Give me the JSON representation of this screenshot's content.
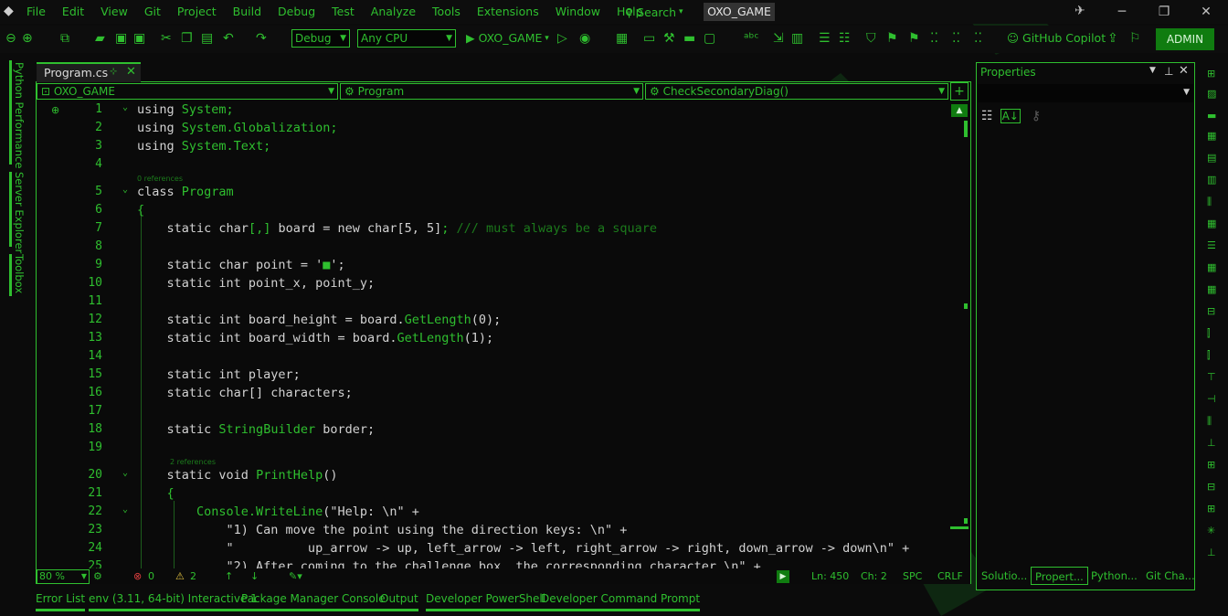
{
  "menu": [
    "File",
    "Edit",
    "View",
    "Git",
    "Project",
    "Build",
    "Debug",
    "Test",
    "Analyze",
    "Tools",
    "Extensions",
    "Window",
    "Help"
  ],
  "search_label": "Search",
  "window_title": "OXO_GAME",
  "toolbar": {
    "config": "Debug",
    "platform": "Any CPU",
    "run_target": "OXO_GAME",
    "copilot": "GitHub Copilot",
    "admin": "ADMIN"
  },
  "left_tabs": [
    "Python Performance",
    "Server Explorer",
    "Toolbox"
  ],
  "doc_tab": "Program.cs",
  "nav": {
    "project": "OXO_GAME",
    "type": "Program",
    "member": "CheckSecondaryDiag()"
  },
  "code_lines": [
    {
      "n": "1",
      "parts": [
        [
          "kw",
          "using "
        ],
        [
          "ty",
          "System;"
        ]
      ]
    },
    {
      "n": "2",
      "parts": [
        [
          "kw",
          "using "
        ],
        [
          "ty",
          "System.Globalization;"
        ]
      ]
    },
    {
      "n": "3",
      "parts": [
        [
          "kw",
          "using "
        ],
        [
          "ty",
          "System.Text;"
        ]
      ]
    },
    {
      "n": "4",
      "parts": []
    },
    {
      "n": "5",
      "parts": [
        [
          "kw",
          "class "
        ],
        [
          "ty",
          "Program"
        ]
      ]
    },
    {
      "n": "6",
      "parts": [
        [
          "ty",
          "{"
        ]
      ]
    },
    {
      "n": "7",
      "parts": [
        [
          "ty",
          "    "
        ],
        [
          "kw",
          "static "
        ],
        [
          "kw",
          "char"
        ],
        [
          "ty",
          "[,] "
        ],
        [
          "kw",
          "board"
        ],
        [
          "kw",
          " = new char"
        ],
        [
          "kw",
          "[5, 5]"
        ],
        [
          "ty",
          "; "
        ],
        [
          "cm",
          "/// must always be a square"
        ]
      ]
    },
    {
      "n": "8",
      "parts": []
    },
    {
      "n": "9",
      "parts": [
        [
          "ty",
          "    "
        ],
        [
          "kw",
          "static char point = '"
        ],
        [
          "ty",
          "■"
        ],
        [
          "kw",
          "';"
        ]
      ]
    },
    {
      "n": "10",
      "parts": [
        [
          "ty",
          "    "
        ],
        [
          "kw",
          "static int point_x, point_y;"
        ]
      ]
    },
    {
      "n": "11",
      "parts": []
    },
    {
      "n": "12",
      "parts": [
        [
          "ty",
          "    "
        ],
        [
          "kw",
          "static int board_height = board."
        ],
        [
          "ty",
          "GetLength"
        ],
        [
          "kw",
          "(0);"
        ]
      ]
    },
    {
      "n": "13",
      "parts": [
        [
          "ty",
          "    "
        ],
        [
          "kw",
          "static int board_width = board."
        ],
        [
          "ty",
          "GetLength"
        ],
        [
          "kw",
          "(1);"
        ]
      ]
    },
    {
      "n": "14",
      "parts": []
    },
    {
      "n": "15",
      "parts": [
        [
          "ty",
          "    "
        ],
        [
          "kw",
          "static int player;"
        ]
      ]
    },
    {
      "n": "16",
      "parts": [
        [
          "ty",
          "    "
        ],
        [
          "kw",
          "static char[] characters;"
        ]
      ]
    },
    {
      "n": "17",
      "parts": []
    },
    {
      "n": "18",
      "parts": [
        [
          "ty",
          "    "
        ],
        [
          "kw",
          "static "
        ],
        [
          "ty",
          "StringBuilder"
        ],
        [
          "kw",
          " border;"
        ]
      ]
    },
    {
      "n": "19",
      "parts": []
    },
    {
      "n": "20",
      "parts": [
        [
          "ty",
          "    "
        ],
        [
          "kw",
          "static void "
        ],
        [
          "ty",
          "PrintHelp"
        ],
        [
          "kw",
          "()"
        ]
      ]
    },
    {
      "n": "21",
      "parts": [
        [
          "ty",
          "    {"
        ]
      ]
    },
    {
      "n": "22",
      "parts": [
        [
          "ty",
          "        Console."
        ],
        [
          "ty",
          "WriteLine"
        ],
        [
          "kw",
          "(\"Help: \\n\" +"
        ]
      ]
    },
    {
      "n": "23",
      "parts": [
        [
          "kw",
          "            \"1) Can move the point using the direction keys: \\n\" +"
        ]
      ]
    },
    {
      "n": "24",
      "parts": [
        [
          "kw",
          "            \"          up_arrow -> up, left_arrow -> left, right_arrow -> right, down_arrow -> down\\n\" +"
        ]
      ]
    },
    {
      "n": "25",
      "parts": [
        [
          "kw",
          "            \"2) After coming to the challenge box, the corresponding character \\n\" +"
        ]
      ]
    }
  ],
  "ref_labels": {
    "class": "0 references",
    "method": "2 references"
  },
  "status": {
    "zoom": "80 %",
    "errors": "0",
    "warnings": "2",
    "ln": "Ln: 450",
    "ch": "Ch: 2",
    "spc": "SPC",
    "crlf": "CRLF"
  },
  "properties": {
    "title": "Properties",
    "tabs": [
      "Solutio...",
      "Propert...",
      "Python...",
      "Git Cha..."
    ]
  },
  "bottom_tabs": [
    "Error List",
    "env (3.11, 64-bit) Interactive 1",
    "Package Manager Console",
    "Output",
    "Developer PowerShell",
    "Developer Command Prompt"
  ],
  "colors": {
    "accent": "#2fbf2f",
    "admin_bg": "#107c10",
    "background": "#0b0b0b",
    "keyword": "#d2d2d2"
  }
}
